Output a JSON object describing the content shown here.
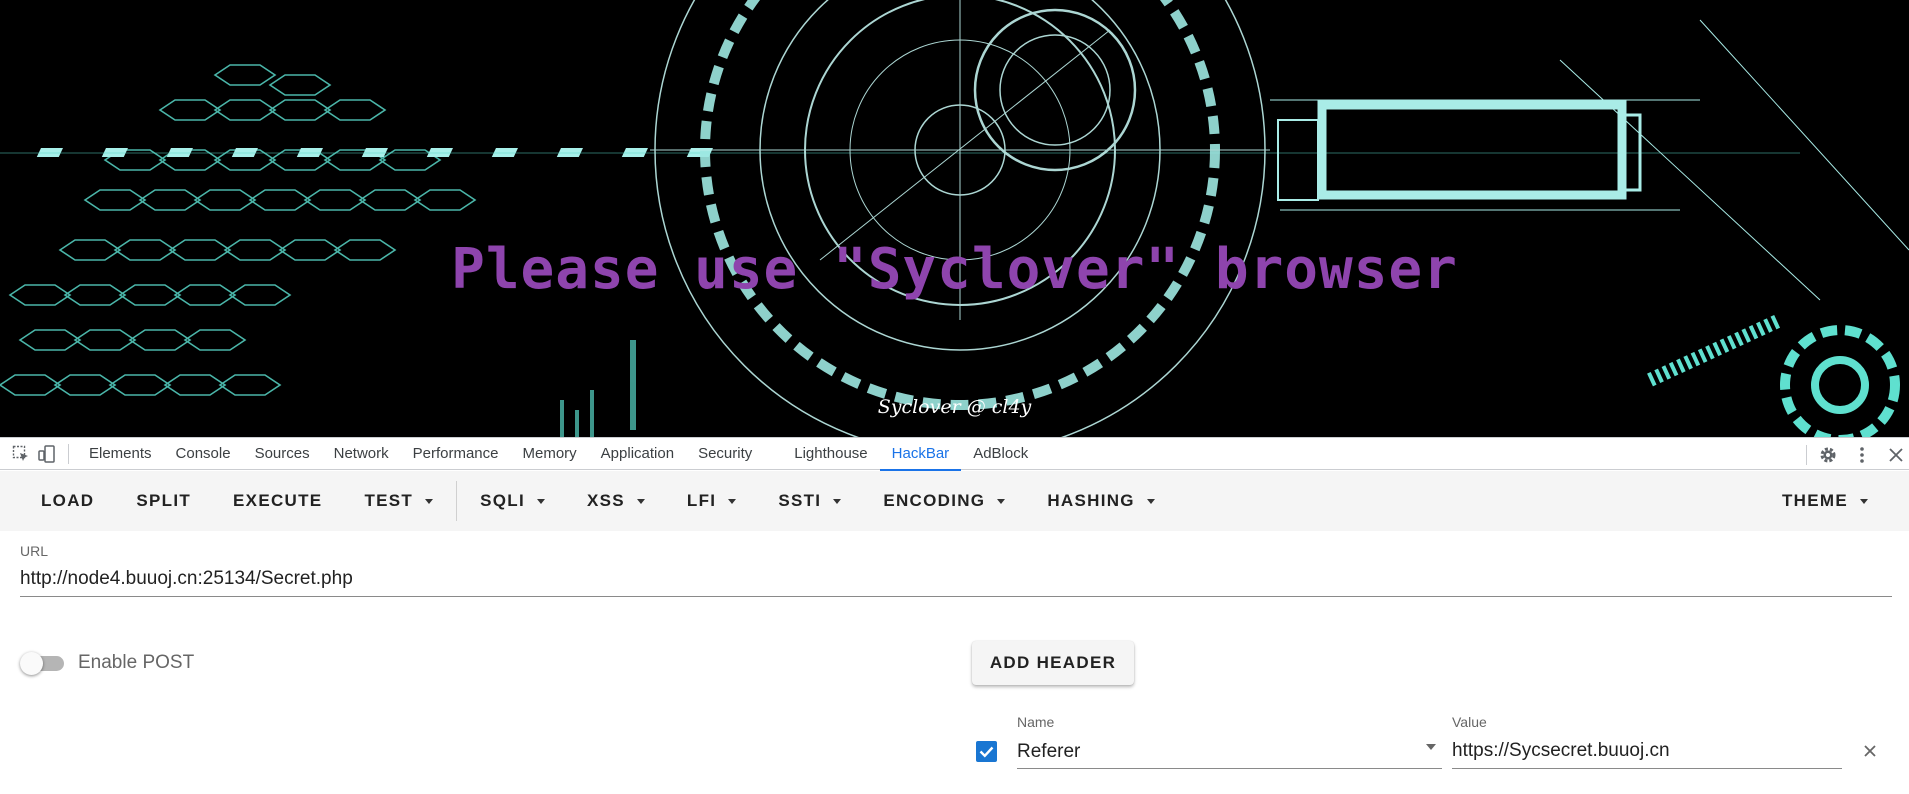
{
  "hero": {
    "title": "Please use \"Syclover\" browser",
    "credit": "Syclover @ cl4y",
    "colors": {
      "background": "#000000",
      "title": "#8e44ad",
      "accent": "#5ce1e6"
    }
  },
  "devtools": {
    "left_icons": [
      "inspect-element-icon",
      "device-toolbar-icon"
    ],
    "tabs": [
      {
        "label": "Elements"
      },
      {
        "label": "Console"
      },
      {
        "label": "Sources"
      },
      {
        "label": "Network"
      },
      {
        "label": "Performance"
      },
      {
        "label": "Memory"
      },
      {
        "label": "Application"
      },
      {
        "label": "Security"
      },
      {
        "label": "Lighthouse"
      },
      {
        "label": "HackBar"
      },
      {
        "label": "AdBlock"
      }
    ],
    "active_tab": "HackBar",
    "right_icons": [
      "settings-gear-icon",
      "more-options-icon",
      "close-devtools-icon"
    ]
  },
  "hackbar": {
    "toolbar": {
      "load": "LOAD",
      "split": "SPLIT",
      "execute": "EXECUTE",
      "test": "TEST",
      "sqli": "SQLI",
      "xss": "XSS",
      "lfi": "LFI",
      "ssti": "SSTI",
      "encoding": "ENCODING",
      "hashing": "HASHING",
      "theme": "THEME"
    },
    "url": {
      "label": "URL",
      "value": "http://node4.buuoj.cn:25134/Secret.php"
    },
    "post": {
      "label": "Enable POST",
      "enabled": false
    },
    "add_header": "ADD HEADER",
    "header_row": {
      "enabled": true,
      "name_label": "Name",
      "name_value": "Referer",
      "value_label": "Value",
      "value": "https://Sycsecret.buuoj.cn"
    }
  },
  "colors": {
    "accent_blue": "#1a73e8",
    "checkbox_blue": "#1976d2"
  }
}
